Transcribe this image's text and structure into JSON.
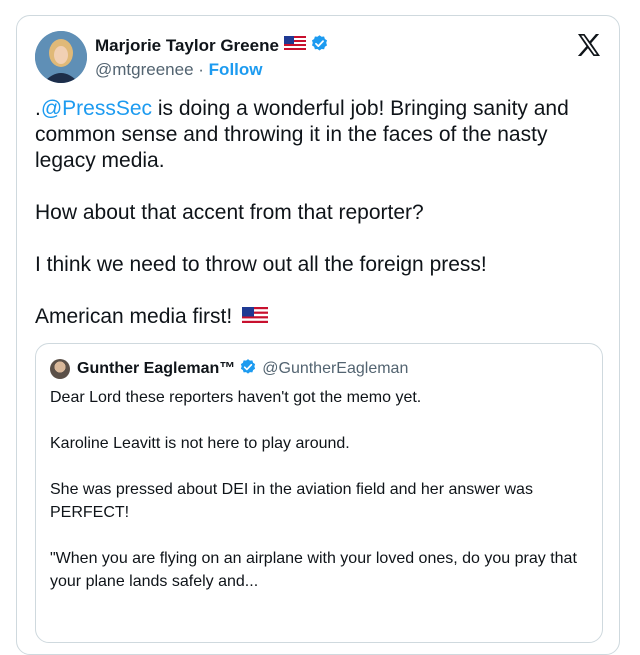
{
  "author": {
    "display_name": "Marjorie Taylor Greene",
    "handle": "@mtgreenee",
    "separator": "·",
    "follow_label": "Follow",
    "avatar_icon": "profile-photo",
    "flag_icon": "us-flag",
    "verified_icon": "verified-badge"
  },
  "platform": {
    "logo_icon": "x-logo"
  },
  "tweet": {
    "mention": "@PressSec",
    "line1_prefix": ".",
    "line1_rest": " is doing a wonderful job! Bringing sanity and common sense and throwing it in the faces of the nasty legacy media.",
    "line2": "How about that accent from that reporter?",
    "line3": "I think we need to throw out all the foreign press!",
    "line4": "American media first!",
    "line4_flag_icon": "us-flag"
  },
  "quoted": {
    "display_name": "Gunther Eagleman™",
    "handle": "@GuntherEagleman",
    "verified_icon": "verified-badge",
    "lines": [
      "Dear Lord these reporters haven't got the memo yet.",
      "Karoline Leavitt is not here to play around.",
      "She was pressed about DEI in the aviation field and her answer was PERFECT!",
      "\"When you are flying on an airplane with your loved ones, do you pray that your plane lands safely and..."
    ]
  },
  "colors": {
    "link": "#1d9bf0",
    "muted": "#536471",
    "text": "#0f1419",
    "border": "#cfd9de"
  }
}
